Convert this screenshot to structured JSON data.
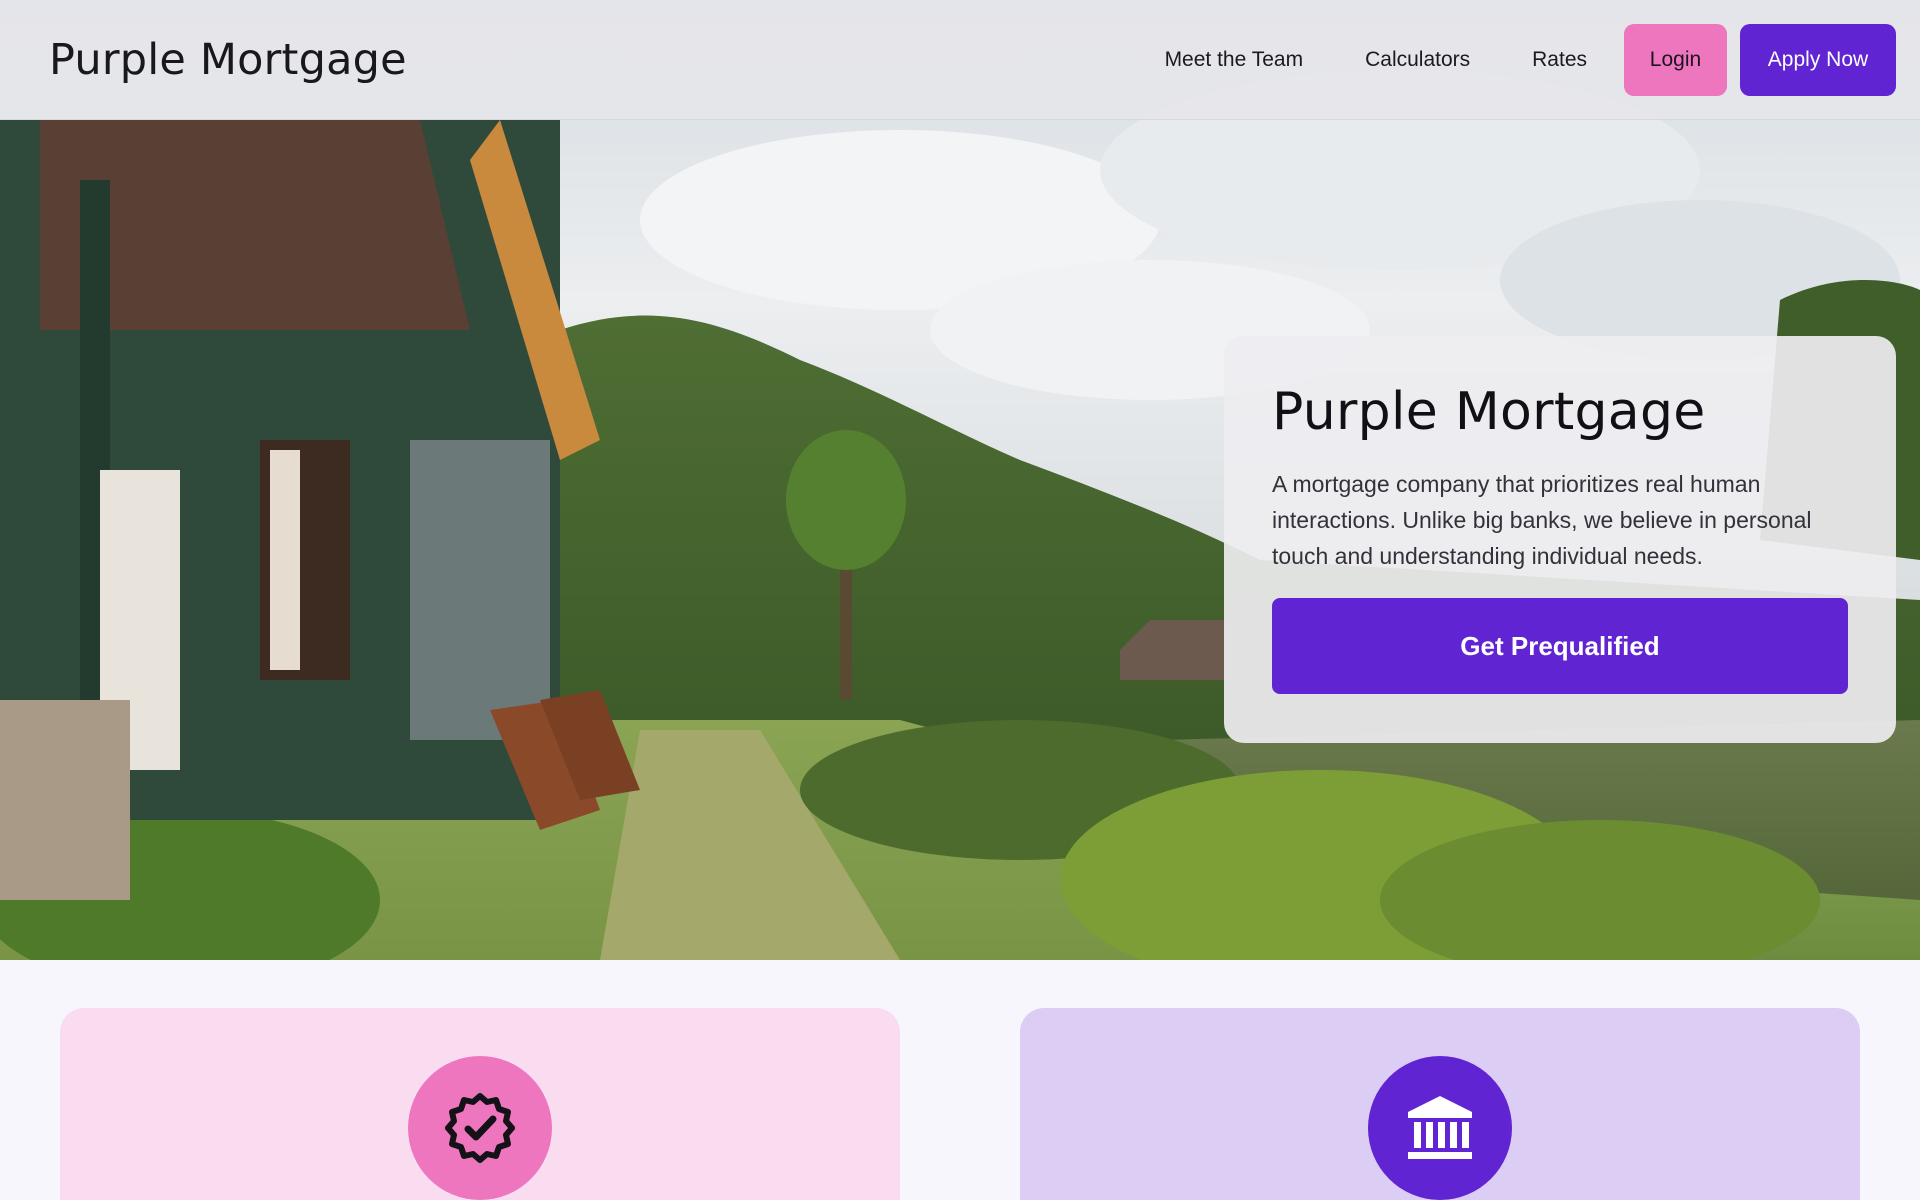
{
  "header": {
    "brand": "Purple Mortgage",
    "nav": [
      "Meet the Team",
      "Calculators",
      "Rates"
    ],
    "login_label": "Login",
    "apply_label": "Apply Now"
  },
  "hero": {
    "title": "Purple Mortgage",
    "description": "A mortgage company that prioritizes real human interactions. Unlike big banks, we believe in personal touch and understanding individual needs.",
    "cta_label": "Get Prequalified"
  },
  "features": [
    {
      "icon": "verified-badge-icon"
    },
    {
      "icon": "bank-building-icon"
    }
  ],
  "colors": {
    "primary_purple": "#6024d2",
    "pink": "#ee76be",
    "pink_card": "#f9dcef",
    "lavender_card": "#dccdf4",
    "page_bg": "#f7f6fc"
  }
}
